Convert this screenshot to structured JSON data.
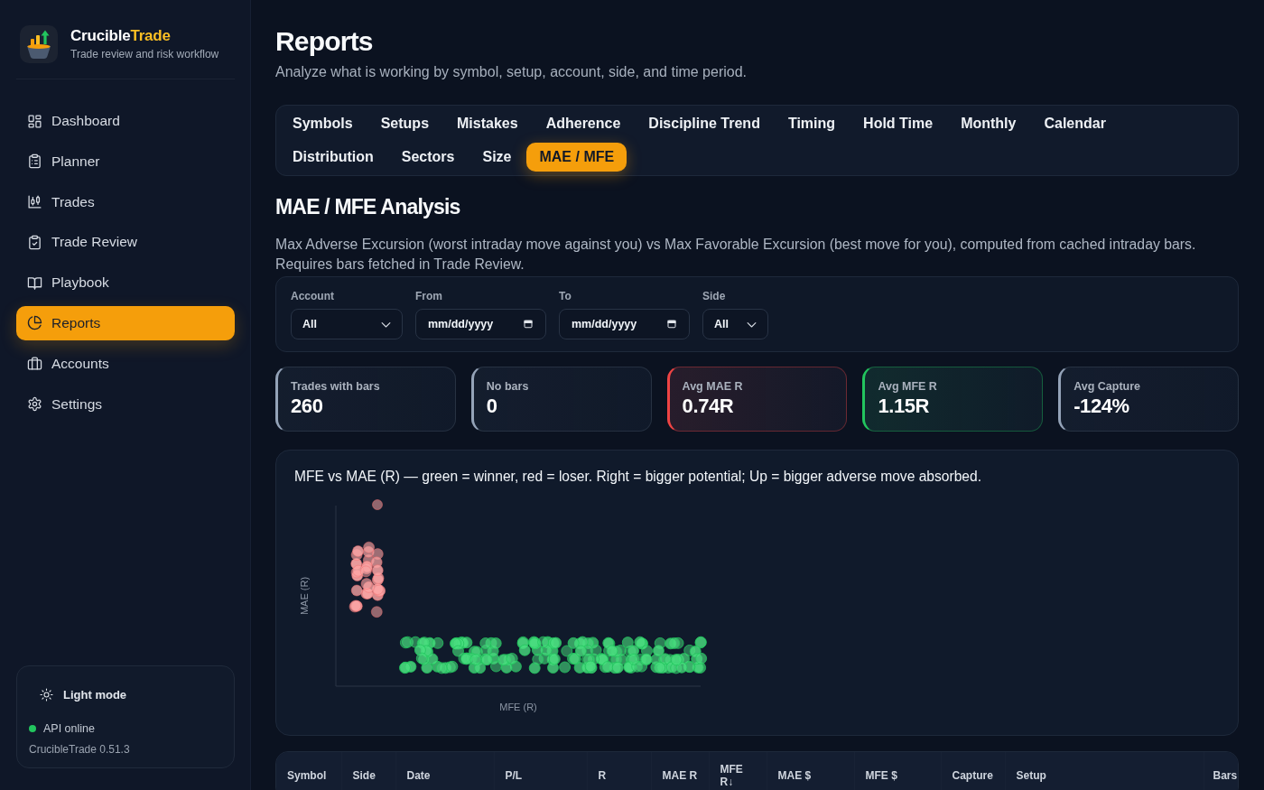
{
  "sidebar": {
    "brand": {
      "name": "Crucible",
      "accent": "Trade",
      "tagline": "Trade review and risk workflow"
    },
    "nav": [
      {
        "label": "Dashboard",
        "selected": false
      },
      {
        "label": "Planner",
        "selected": false
      },
      {
        "label": "Trades",
        "selected": false
      },
      {
        "label": "Trade Review",
        "selected": false
      },
      {
        "label": "Playbook",
        "selected": false
      },
      {
        "label": "Reports",
        "selected": true
      },
      {
        "label": "Accounts",
        "selected": false
      },
      {
        "label": "Settings",
        "selected": false
      }
    ],
    "footer": {
      "theme_toggle": "Light mode",
      "api_status": {
        "label": "API online",
        "online": true
      },
      "version": "CrucibleTrade 0.51.3"
    }
  },
  "page": {
    "title": "Reports",
    "subtitle": "Analyze what is working by symbol, setup, account, side, and time period."
  },
  "tabs": [
    {
      "label": "Symbols",
      "selected": false
    },
    {
      "label": "Setups",
      "selected": false
    },
    {
      "label": "Mistakes",
      "selected": false
    },
    {
      "label": "Adherence",
      "selected": false
    },
    {
      "label": "Discipline Trend",
      "selected": false
    },
    {
      "label": "Timing",
      "selected": false
    },
    {
      "label": "Hold Time",
      "selected": false
    },
    {
      "label": "Monthly",
      "selected": false
    },
    {
      "label": "Calendar",
      "selected": false
    },
    {
      "label": "Distribution",
      "selected": false
    },
    {
      "label": "Sectors",
      "selected": false
    },
    {
      "label": "Size",
      "selected": false
    },
    {
      "label": "MAE / MFE",
      "selected": true
    }
  ],
  "section": {
    "title": "MAE / MFE Analysis",
    "description": "Max Adverse Excursion (worst intraday move against you) vs Max Favorable Excursion (best move for you), computed from cached intraday bars. Requires bars fetched in Trade Review."
  },
  "filters": [
    {
      "kind": "select",
      "label": "Account",
      "value": "All"
    },
    {
      "kind": "date",
      "label": "From",
      "placeholder": "mm/dd/yyyy"
    },
    {
      "kind": "date",
      "label": "To",
      "placeholder": "mm/dd/yyyy"
    },
    {
      "kind": "select",
      "label": "Side",
      "value": "All"
    }
  ],
  "stats": [
    {
      "label": "Trades with bars",
      "value": "260",
      "color": "#94a3b8"
    },
    {
      "label": "No bars",
      "value": "0",
      "color": "#94a3b8"
    },
    {
      "label": "Avg MAE R",
      "value": "0.74R",
      "color": "#ef4444"
    },
    {
      "label": "Avg MFE R",
      "value": "1.15R",
      "color": "#22c55e"
    },
    {
      "label": "Avg Capture",
      "value": "-124%",
      "color": "#94a3b8"
    }
  ],
  "chart": {
    "title": "MFE vs MAE (R) — green = winner, red = loser. Right = bigger potential; Up = bigger adverse move absorbed.",
    "xlabel": "MFE (R)",
    "ylabel": "MAE (R)"
  },
  "table": {
    "columns": [
      {
        "label": "Symbol"
      },
      {
        "label": "Side"
      },
      {
        "label": "Date"
      },
      {
        "label": "P/L"
      },
      {
        "label": "R"
      },
      {
        "label": "MAE R"
      },
      {
        "label": "MFE R↓"
      },
      {
        "label": "MAE $"
      },
      {
        "label": "MFE $"
      },
      {
        "label": "Capture"
      },
      {
        "label": "Setup"
      },
      {
        "label": "Bars"
      }
    ]
  }
}
